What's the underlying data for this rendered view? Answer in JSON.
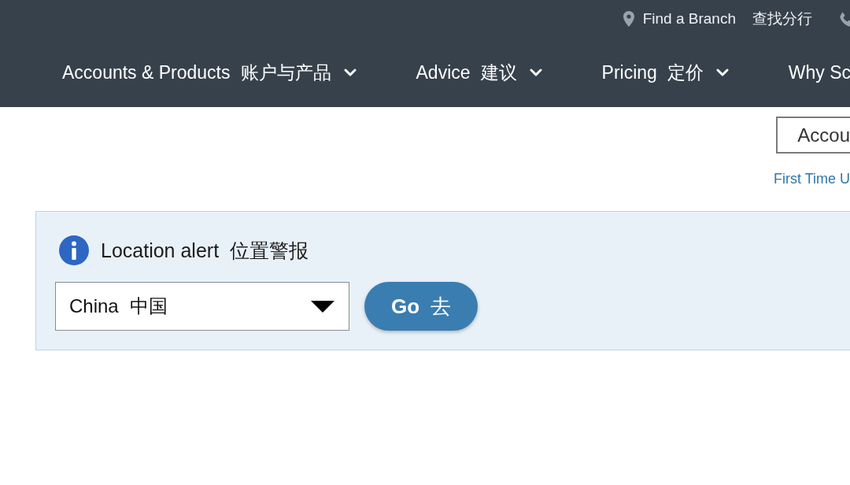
{
  "utility_bar": {
    "items": [
      {
        "kind": "location",
        "label": "Find a Branch",
        "label_zh": "查找分行"
      },
      {
        "kind": "phone"
      }
    ]
  },
  "nav": {
    "items": [
      {
        "label": "Accounts & Products",
        "label_zh": "账户与产品",
        "has_menu": true
      },
      {
        "label": "Advice",
        "label_zh": "建议",
        "has_menu": true
      },
      {
        "label": "Pricing",
        "label_zh": "定价",
        "has_menu": true
      },
      {
        "label": "Why Sc",
        "has_menu": false
      }
    ]
  },
  "account_area": {
    "account_select": {
      "value": "Accou"
    },
    "first_time_link": {
      "label": "First Time U"
    }
  },
  "location_alert": {
    "title": "Location alert",
    "title_zh": "位置警报",
    "country_select": {
      "value": "China",
      "value_zh": "中国"
    },
    "go_button": {
      "label": "Go",
      "label_zh": "去"
    }
  }
}
